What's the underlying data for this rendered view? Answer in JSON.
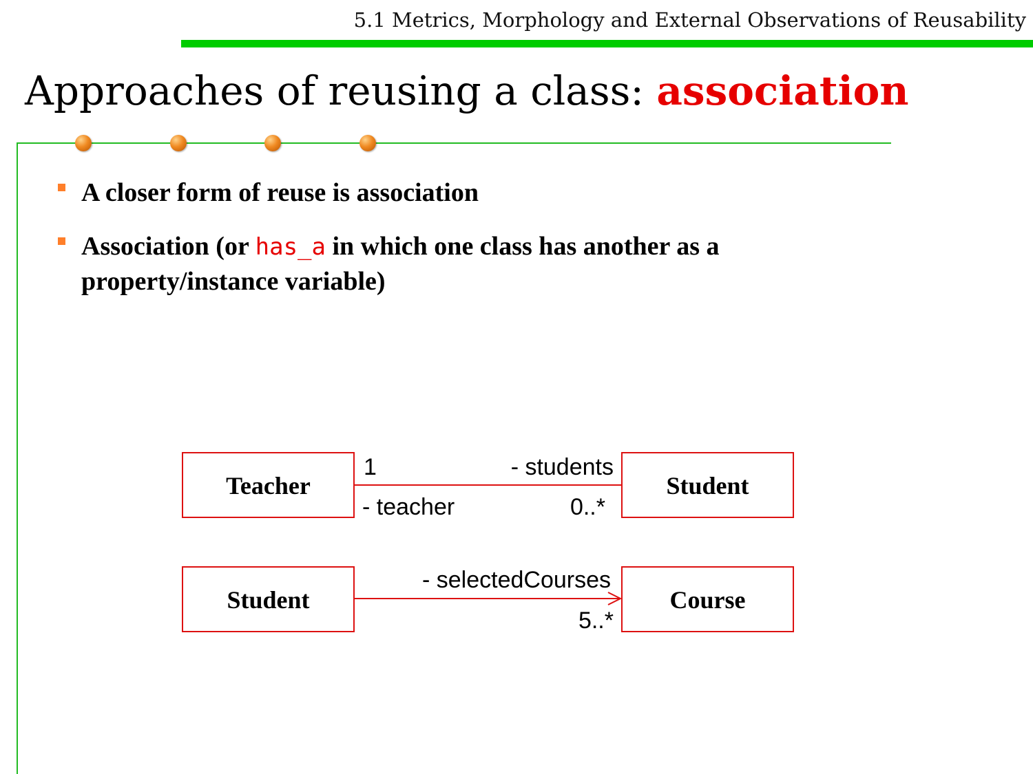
{
  "header": {
    "section": "5.1 Metrics, Morphology and External Observations of Reusability"
  },
  "title": {
    "prefix": "Approaches of reusing a class: ",
    "keyword": "association"
  },
  "bullets": [
    {
      "text": "A closer form of reuse is association"
    },
    {
      "before": "Association (or ",
      "code": "has_a",
      "after": " in which one class has another as a property/instance variable)"
    }
  ],
  "diagram": {
    "associations": [
      {
        "source": "Teacher",
        "target": "Student",
        "source_multiplicity": "1",
        "source_role": "- teacher",
        "target_role": "- students",
        "target_multiplicity": "0..*",
        "navigable": false
      },
      {
        "source": "Student",
        "target": "Course",
        "target_role": "- selectedCourses",
        "target_multiplicity": "5..*",
        "navigable": true
      }
    ]
  },
  "colors": {
    "accent": "#e60000",
    "header_bar": "#00cc00",
    "frame": "#22bb22",
    "uml_stroke": "#dd1111",
    "bullet": "#ff7f2a"
  }
}
